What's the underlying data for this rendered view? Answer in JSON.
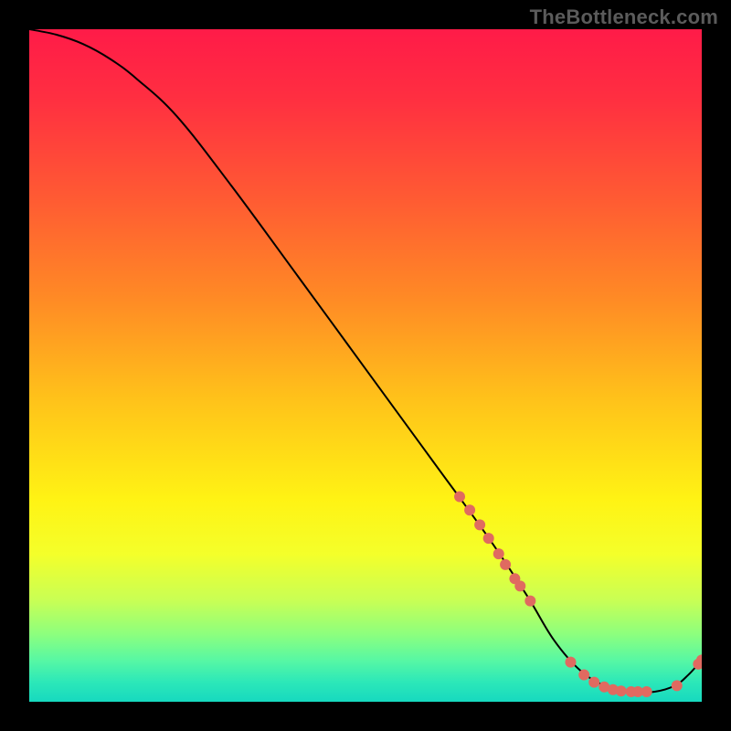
{
  "attribution": "TheBottleneck.com",
  "chart_data": {
    "type": "line",
    "title": "",
    "xlabel": "",
    "ylabel": "",
    "xlim": [
      0,
      100
    ],
    "ylim": [
      0,
      100
    ],
    "grid": false,
    "legend": false,
    "background_gradient_stops": [
      {
        "offset": 0.0,
        "color": "#ff1b48"
      },
      {
        "offset": 0.1,
        "color": "#ff2e41"
      },
      {
        "offset": 0.25,
        "color": "#ff5a33"
      },
      {
        "offset": 0.4,
        "color": "#ff8a25"
      },
      {
        "offset": 0.55,
        "color": "#ffc21a"
      },
      {
        "offset": 0.7,
        "color": "#fff314"
      },
      {
        "offset": 0.78,
        "color": "#f4ff2a"
      },
      {
        "offset": 0.85,
        "color": "#c8ff55"
      },
      {
        "offset": 0.9,
        "color": "#8cff7e"
      },
      {
        "offset": 0.94,
        "color": "#55f7a5"
      },
      {
        "offset": 0.97,
        "color": "#2de8b8"
      },
      {
        "offset": 1.0,
        "color": "#17d9bf"
      }
    ],
    "series": [
      {
        "name": "bottleneck-curve",
        "color": "#000000",
        "stroke_width": 2,
        "x": [
          0,
          4,
          8,
          12,
          16,
          22,
          30,
          40,
          50,
          60,
          68,
          74,
          78,
          82,
          86,
          90,
          93,
          96,
          98,
          100
        ],
        "y": [
          100,
          99.2,
          97.8,
          95.6,
          92.6,
          87.0,
          76.8,
          63.2,
          49.5,
          35.8,
          24.8,
          15.8,
          9.2,
          4.6,
          2.2,
          1.5,
          1.5,
          2.4,
          4.0,
          6.2
        ]
      }
    ],
    "markers": {
      "name": "highlight-dots",
      "color": "#e06a60",
      "radius_px": 6,
      "points": [
        {
          "x": 64.0,
          "y": 30.5
        },
        {
          "x": 65.5,
          "y": 28.5
        },
        {
          "x": 67.0,
          "y": 26.3
        },
        {
          "x": 68.3,
          "y": 24.3
        },
        {
          "x": 69.8,
          "y": 22.0
        },
        {
          "x": 70.8,
          "y": 20.4
        },
        {
          "x": 72.2,
          "y": 18.3
        },
        {
          "x": 73.0,
          "y": 17.2
        },
        {
          "x": 74.5,
          "y": 15.0
        },
        {
          "x": 80.5,
          "y": 5.9
        },
        {
          "x": 82.5,
          "y": 4.0
        },
        {
          "x": 84.0,
          "y": 2.9
        },
        {
          "x": 85.5,
          "y": 2.2
        },
        {
          "x": 86.8,
          "y": 1.8
        },
        {
          "x": 88.0,
          "y": 1.6
        },
        {
          "x": 89.5,
          "y": 1.5
        },
        {
          "x": 90.5,
          "y": 1.5
        },
        {
          "x": 91.8,
          "y": 1.5
        },
        {
          "x": 96.3,
          "y": 2.4
        },
        {
          "x": 99.5,
          "y": 5.6
        },
        {
          "x": 100.0,
          "y": 6.2
        }
      ]
    }
  }
}
